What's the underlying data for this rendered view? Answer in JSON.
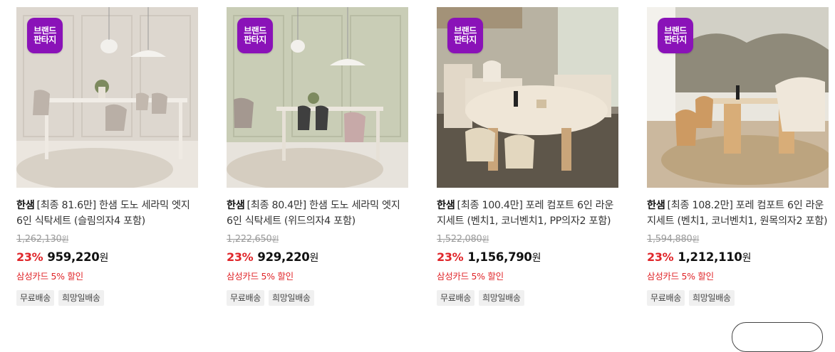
{
  "badge": {
    "line1": "브랜드",
    "line2": "판타지"
  },
  "products": [
    {
      "brand": "한샘",
      "title": "[최종 81.6만] 한샘 도노 세라믹 엣지 6인 식탁세트 (슬림의자4 포함)",
      "original_price": "1,262,130",
      "discount": "23%",
      "price": "959,220",
      "price_unit": "원",
      "orig_unit": "원",
      "promo": "삼성카드 5% 할인",
      "tags": [
        "무료배송",
        "희망일배송"
      ]
    },
    {
      "brand": "한샘",
      "title": "[최종 80.4만] 한샘 도노 세라믹 엣지 6인 식탁세트 (위드의자4 포함)",
      "original_price": "1,222,650",
      "discount": "23%",
      "price": "929,220",
      "price_unit": "원",
      "orig_unit": "원",
      "promo": "삼성카드 5% 할인",
      "tags": [
        "무료배송",
        "희망일배송"
      ]
    },
    {
      "brand": "한샘",
      "title": "[최종 100.4만] 포레 컴포트 6인 라운지세트 (벤치1, 코너벤치1, PP의자2 포함)",
      "original_price": "1,522,080",
      "discount": "23%",
      "price": "1,156,790",
      "price_unit": "원",
      "orig_unit": "원",
      "promo": "삼성카드 5% 할인",
      "tags": [
        "무료배송",
        "희망일배송"
      ]
    },
    {
      "brand": "한샘",
      "title": "[최종 108.2만] 포레 컴포트 6인 라운지세트 (벤치1, 코너벤치1, 원목의자2 포함)",
      "original_price": "1,594,880",
      "discount": "23%",
      "price": "1,212,110",
      "price_unit": "원",
      "orig_unit": "원",
      "promo": "삼성카드 5% 할인",
      "tags": [
        "무료배송",
        "희망일배송"
      ]
    }
  ],
  "colors": {
    "badge": "#8a12b8",
    "discount": "#e0262a",
    "promo": "#e0262a"
  }
}
